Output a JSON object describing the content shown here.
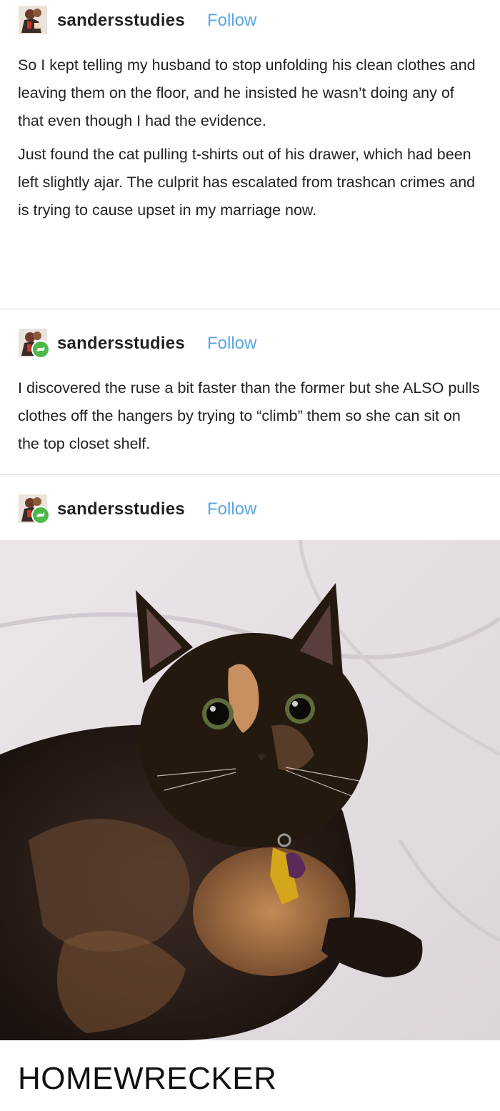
{
  "posts": [
    {
      "username": "sandersstudies",
      "follow_label": "Follow",
      "paragraphs": [
        "So I kept telling my husband to stop unfolding his clean clothes and leaving them on the floor, and he insisted he wasn’t doing any of that even though I had the evidence.",
        "Just found the cat pulling t-shirts out of his drawer, which had been left slightly ajar. The culprit has escalated from trashcan crimes and is trying to cause upset in my marriage now."
      ]
    },
    {
      "username": "sandersstudies",
      "follow_label": "Follow",
      "paragraphs": [
        "I discovered the ruse a bit faster than the former but she ALSO pulls clothes off the hangers by trying to “climb” them so she can sit on the top closet shelf."
      ]
    },
    {
      "username": "sandersstudies",
      "follow_label": "Follow"
    }
  ],
  "caption": "HOMEWRECKER",
  "colors": {
    "follow": "#5aa6e0",
    "reblog_badge": "#4fb84a",
    "divider": "#dcdcdc"
  }
}
